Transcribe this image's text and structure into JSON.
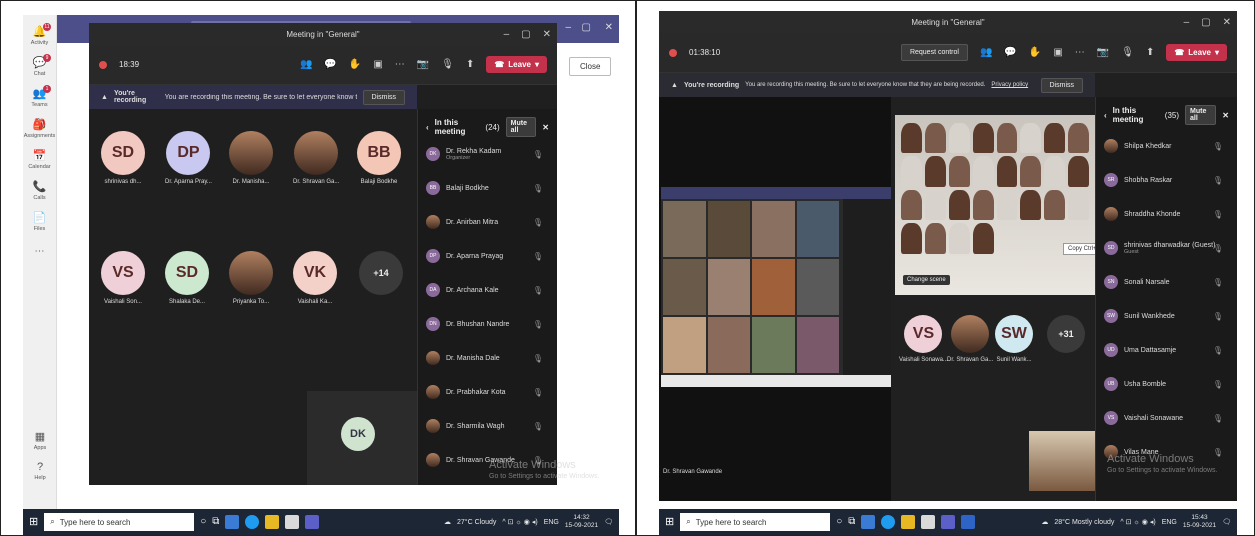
{
  "left": {
    "rail": [
      {
        "label": "Activity",
        "icon": "bell-icon",
        "glyph": "🔔",
        "badge": "11"
      },
      {
        "label": "Chat",
        "icon": "chat-icon",
        "glyph": "💬",
        "badge": "9"
      },
      {
        "label": "Teams",
        "icon": "teams-icon",
        "glyph": "👥",
        "badge": "1"
      },
      {
        "label": "Assignments",
        "icon": "assignments-icon",
        "glyph": "🎒",
        "badge": ""
      },
      {
        "label": "Calendar",
        "icon": "calendar-icon",
        "glyph": "📅",
        "badge": ""
      },
      {
        "label": "Calls",
        "icon": "calls-icon",
        "glyph": "📞",
        "badge": ""
      },
      {
        "label": "Files",
        "icon": "files-icon",
        "glyph": "📄",
        "badge": ""
      }
    ],
    "rail_bottom": [
      {
        "label": "Apps"
      },
      {
        "label": "Help"
      }
    ],
    "close_label": "Close",
    "window_title": "Meeting in \"General\"",
    "timer": "18:39",
    "leave_label": "Leave",
    "banner_title": "You're recording",
    "banner_text": "You are recording this meeting. Be sure to let everyone know that they are ...",
    "dismiss_label": "Dismiss",
    "tiles_row1": [
      {
        "initials": "SD",
        "name": "shrinivas dh...",
        "color": "#f1c9c0"
      },
      {
        "initials": "DP",
        "name": "Dr. Aparna Pray...",
        "color": "#c8c8f0"
      },
      {
        "initials": "",
        "name": "Dr. Manisha...",
        "color": "photo"
      },
      {
        "initials": "",
        "name": "Dr. Shravan Ga...",
        "color": "photo"
      },
      {
        "initials": "BB",
        "name": "Balaji Bodkhe",
        "color": "#f3c6b6"
      }
    ],
    "tiles_row2": [
      {
        "initials": "VS",
        "name": "Vaishali Son...",
        "color": "#f0d0d8"
      },
      {
        "initials": "SD",
        "name": "Shalaka De...",
        "color": "#cce9cf"
      },
      {
        "initials": "",
        "name": "Priyanka To...",
        "color": "photo"
      },
      {
        "initials": "VK",
        "name": "Vaishali Ka...",
        "color": "#f3d0c8"
      }
    ],
    "overflow": "+14",
    "self_initials": "DK",
    "panel_title": "In this meeting",
    "panel_count": "(24)",
    "mute_all": "Mute all",
    "participants": [
      {
        "name": "Dr. Rekha Kadam",
        "sub": "Organizer",
        "initials": "DK"
      },
      {
        "name": "Balaji Bodkhe",
        "sub": "",
        "initials": "BB"
      },
      {
        "name": "Dr. Anirban Mitra",
        "sub": "",
        "initials": ""
      },
      {
        "name": "Dr. Aparna Prayag",
        "sub": "",
        "initials": "DP"
      },
      {
        "name": "Dr. Archana Kale",
        "sub": "",
        "initials": "DA"
      },
      {
        "name": "Dr. Bhushan Nandre",
        "sub": "",
        "initials": "DN"
      },
      {
        "name": "Dr. Manisha Dale",
        "sub": "",
        "initials": ""
      },
      {
        "name": "Dr. Prabhakar Kota",
        "sub": "",
        "initials": ""
      },
      {
        "name": "Dr. Sharmila Wagh",
        "sub": "",
        "initials": ""
      },
      {
        "name": "Dr. Shravan Gawande",
        "sub": "",
        "initials": ""
      }
    ],
    "watermark_title": "Activate Windows",
    "watermark_sub": "Go to Settings to activate Windows.",
    "taskbar": {
      "search": "Type here to search",
      "weather": "27°C Cloudy",
      "lang": "ENG",
      "time": "14:32",
      "date": "15-09-2021"
    }
  },
  "right": {
    "window_title": "Meeting in \"General\"",
    "timer": "01:38:10",
    "request_control": "Request control",
    "leave_label": "Leave",
    "banner_title": "You're recording",
    "banner_text": "You are recording this meeting. Be sure to let everyone know that they are being recorded.",
    "privacy_link": "Privacy policy",
    "dismiss_label": "Dismiss",
    "change_scene": "Change scene",
    "copy_tooltip": "Copy Ctrl+C",
    "presenter": "Dr. Shravan Gawande",
    "tiles": [
      {
        "initials": "VS",
        "name": "Vaishali Sonawa...",
        "color": "#f0d0d8"
      },
      {
        "initials": "",
        "name": "Dr. Shravan Ga...",
        "color": "photo"
      },
      {
        "initials": "SW",
        "name": "Sunil Wank...",
        "color": "#d0e8f0"
      }
    ],
    "overflow": "+31",
    "panel_title": "In this meeting",
    "panel_count": "(35)",
    "mute_all": "Mute all",
    "participants": [
      {
        "name": "Shilpa Khedkar",
        "sub": "",
        "initials": ""
      },
      {
        "name": "Shobha Raskar",
        "sub": "",
        "initials": "SR"
      },
      {
        "name": "Shraddha Khonde",
        "sub": "",
        "initials": ""
      },
      {
        "name": "shrinivas dharwadkar (Guest)",
        "sub": "Guest",
        "initials": "SD"
      },
      {
        "name": "Sonali Narsale",
        "sub": "",
        "initials": "SN"
      },
      {
        "name": "Sunil Wankhede",
        "sub": "",
        "initials": "SW"
      },
      {
        "name": "Uma Dattasamje",
        "sub": "",
        "initials": "UD"
      },
      {
        "name": "Usha Bomble",
        "sub": "",
        "initials": "UB"
      },
      {
        "name": "Vaishali Sonawane",
        "sub": "",
        "initials": "VS"
      },
      {
        "name": "Vilas Mane",
        "sub": "",
        "initials": ""
      }
    ],
    "watermark_title": "Activate Windows",
    "watermark_sub": "Go to Settings to activate Windows.",
    "taskbar": {
      "search": "Type here to search",
      "weather": "28°C Mostly cloudy",
      "lang": "ENG",
      "time": "15:43",
      "date": "15-09-2021"
    }
  }
}
